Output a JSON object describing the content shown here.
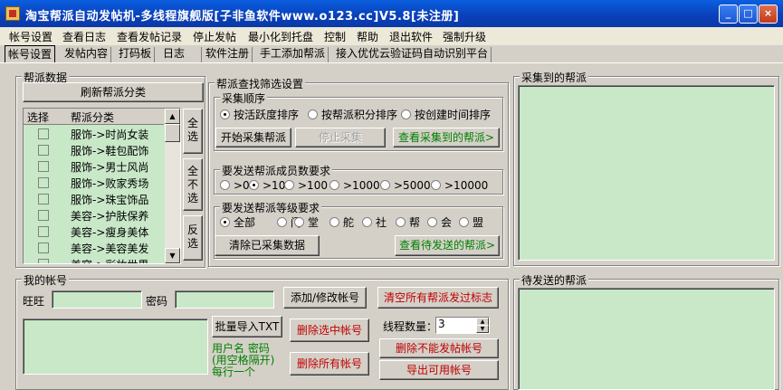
{
  "window": {
    "title": "淘宝帮派自动发帖机-多线程旗舰版[子非鱼软件www.o123.cc]V5.8[未注册]",
    "minimize": "_",
    "maximize": "□",
    "close": "×"
  },
  "menu": [
    "帐号设置",
    "查看日志",
    "查看发帖记录",
    "停止发帖",
    "最小化到托盘",
    "控制",
    "帮助",
    "退出软件",
    "强制升级"
  ],
  "tabs": [
    "帐号设置",
    "发帖内容",
    "打码板",
    "日志",
    "软件注册",
    "手工添加帮派",
    "接入优优云验证码自动识别平台"
  ],
  "faction_data": {
    "title": "帮派数据",
    "refresh_button": "刷新帮派分类",
    "col_select": "选择",
    "col_category": "帮派分类",
    "rows": [
      "服饰->时尚女装",
      "服饰->鞋包配饰",
      "服饰->男士风尚",
      "服饰->败家秀场",
      "服饰->珠宝饰品",
      "美容->护肤保养",
      "美容->瘦身美体",
      "美容->美容美发",
      "美容->彩妆世界"
    ],
    "select_all": "全选",
    "deselect_all": "全不选",
    "invert": "反选"
  },
  "filter": {
    "title": "帮派查找筛选设置",
    "order_title": "采集顺序",
    "order_options": [
      "按活跃度排序",
      "按帮派积分排序",
      "按创建时间排序"
    ],
    "order_selected": 0,
    "start_button": "开始采集帮派",
    "stop_button": "停止采集",
    "view_collected": "查看采集到的帮派>",
    "members_title": "要发送帮派成员数要求",
    "members_options": [
      ">0",
      ">10",
      ">100",
      ">1000",
      ">5000",
      ">10000"
    ],
    "members_selected": 1,
    "level_title": "要发送帮派等级要求",
    "level_options": [
      "全部",
      "门",
      "堂",
      "舵",
      "社",
      "帮",
      "会",
      "盟"
    ],
    "level_selected": 0,
    "clear_button": "清除已采集数据",
    "view_pending": "查看待发送的帮派>"
  },
  "collected": {
    "title": "采集到的帮派"
  },
  "pending": {
    "title": "待发送的帮派"
  },
  "account": {
    "title": "我的帐号",
    "wangwang_label": "旺旺",
    "password_label": "密码",
    "add_button": "添加/修改帐号",
    "clear_flags_button": "清空所有帮派发过标志",
    "import_button": "批量导入TXT",
    "import_hint": [
      "用户名 密码",
      "(用空格隔开)",
      "每行一个"
    ],
    "delete_selected": "删除选中帐号",
    "delete_all": "删除所有帐号",
    "threads_label": "线程数量：",
    "threads_value": "3",
    "delete_unable": "删除不能发帖帐号",
    "export_button": "导出可用帐号"
  }
}
